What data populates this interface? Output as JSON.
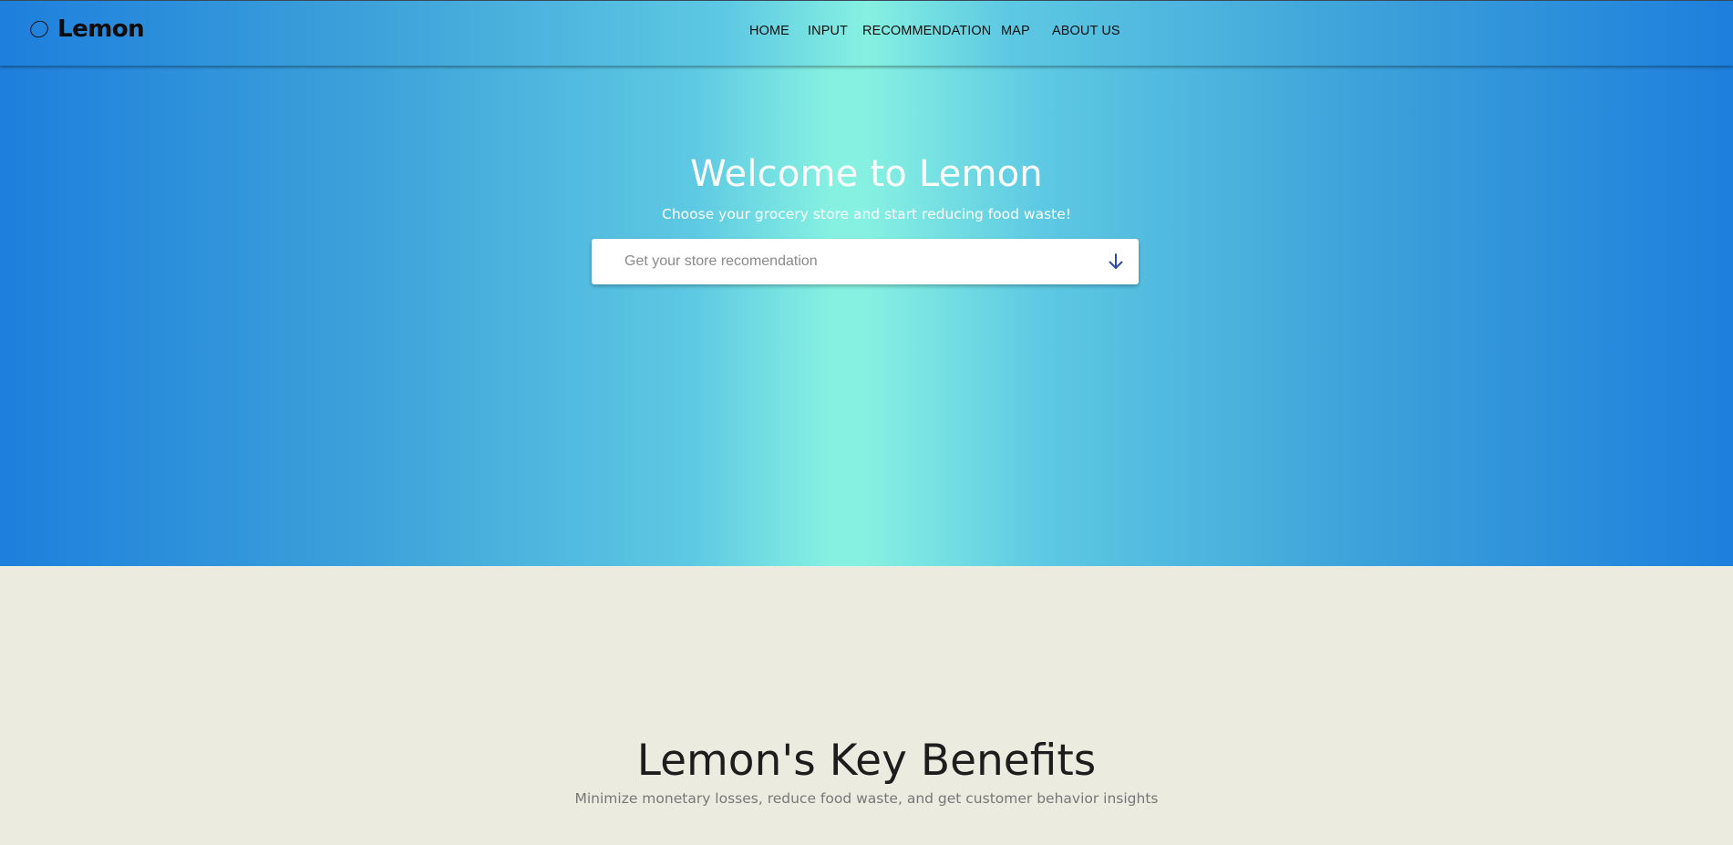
{
  "header": {
    "brand_name": "Lemon",
    "brand_icon": "lemon-outline-icon",
    "nav": [
      {
        "label": "HOME"
      },
      {
        "label": "INPUT"
      },
      {
        "label": "RECOMMENDATION"
      },
      {
        "label": "MAP"
      },
      {
        "label": "ABOUT US"
      }
    ]
  },
  "hero": {
    "title": "Welcome to Lemon",
    "subtitle": "Choose your grocery store and start reducing food waste!",
    "search": {
      "placeholder": "Get your store recomendation",
      "value": "",
      "button_icon": "arrow-down-icon"
    }
  },
  "benefits": {
    "title": "Lemon's Key Benefits",
    "subtitle": "Minimize monetary losses, reduce food waste, and get customer behavior insights"
  },
  "colors": {
    "gradient_edge": "#1e7fdc",
    "gradient_center": "#86f1e1",
    "section_background": "#ecebe0",
    "arrow_icon": "#2f4aa8"
  }
}
